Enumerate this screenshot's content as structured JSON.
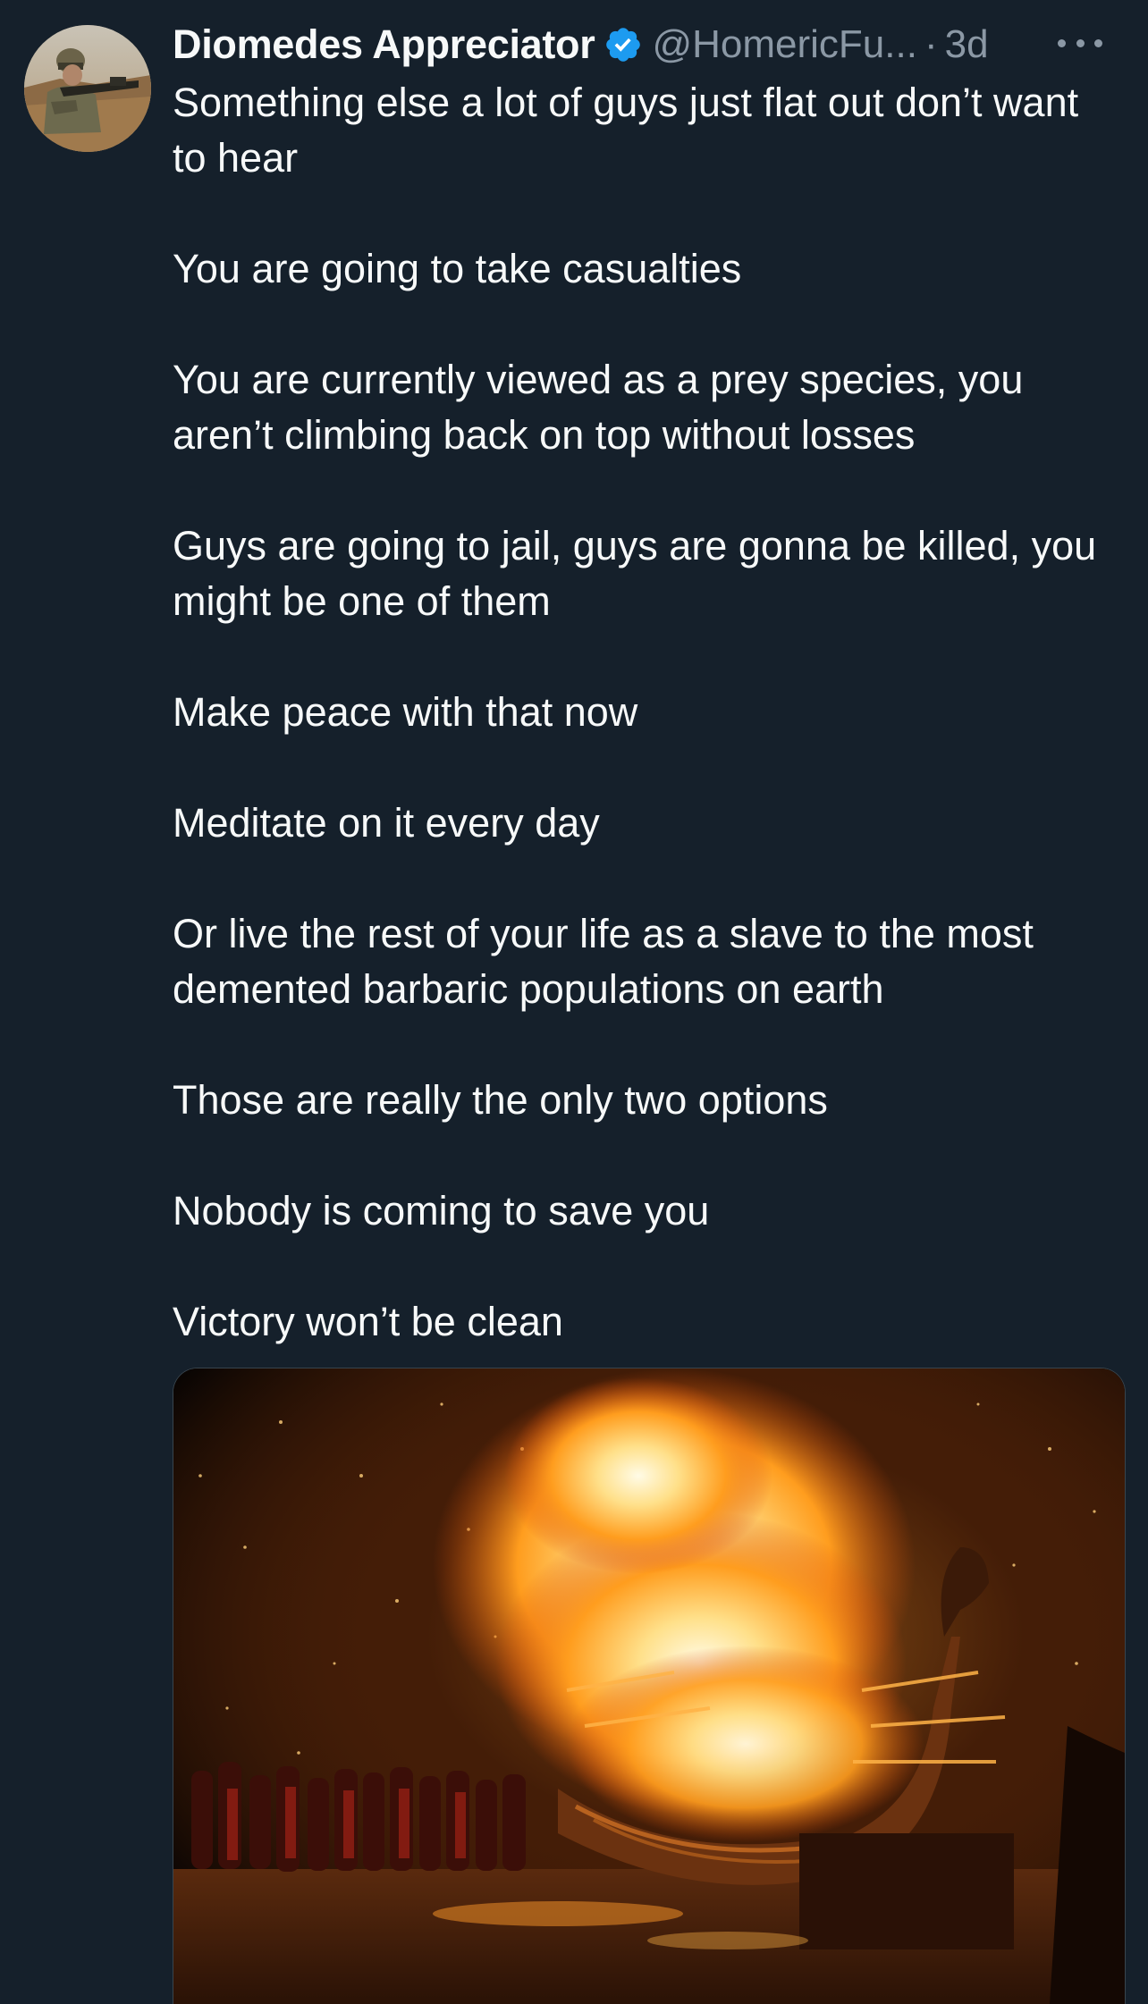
{
  "tweet": {
    "author": {
      "display_name": "Diomedes Appreciator",
      "handle": "@HomericFu...",
      "verified": true,
      "avatar_icon": "soldier-avatar"
    },
    "separator": "·",
    "time": "3d",
    "more_icon": "more-horizontal-icon",
    "paragraphs": [
      "Something else a lot of guys just flat out don’t want to hear",
      "You are going to take casualties",
      "You are currently viewed as a prey species, you aren’t climbing back on top without losses",
      "Guys are going to jail, guys are gonna be killed, you might be one of them",
      "Make peace with that now",
      "Meditate on it every day",
      "Or live the rest of your life as a slave to the most demented barbaric populations on earth",
      "Those are really the only two options",
      "Nobody is coming to save you",
      "Victory won’t be clean"
    ],
    "media": {
      "icon": "burning-viking-ship-image"
    }
  },
  "colors": {
    "background": "#15202b",
    "text": "#f7f9f9",
    "secondary": "#8b98a5",
    "verified": "#1d9bf0"
  }
}
